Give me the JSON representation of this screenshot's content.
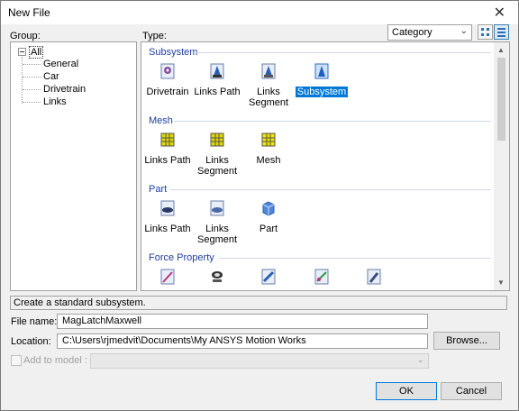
{
  "window": {
    "title": "New File",
    "close_glyph": "✕"
  },
  "group": {
    "label": "Group:",
    "root": "All",
    "children": [
      "General",
      "Car",
      "Drivetrain",
      "Links"
    ]
  },
  "type_panel": {
    "label": "Type:",
    "view_select": "Category",
    "sections": [
      {
        "title": "Subsystem",
        "items": [
          {
            "label": "Drivetrain",
            "icon": "drivetrain-icon"
          },
          {
            "label": "Links Path",
            "icon": "links-path-icon"
          },
          {
            "label": "Links Segment",
            "icon": "links-segment-icon"
          },
          {
            "label": "Subsystem",
            "icon": "subsystem-icon",
            "selected": true
          }
        ]
      },
      {
        "title": "Mesh",
        "items": [
          {
            "label": "Links Path",
            "icon": "mesh-links-path-icon"
          },
          {
            "label": "Links Segment",
            "icon": "mesh-links-segment-icon"
          },
          {
            "label": "Mesh",
            "icon": "mesh-icon"
          }
        ]
      },
      {
        "title": "Part",
        "items": [
          {
            "label": "Links Path",
            "icon": "part-links-path-icon"
          },
          {
            "label": "Links Segment",
            "icon": "part-links-segment-icon"
          },
          {
            "label": "Part",
            "icon": "part-icon"
          }
        ]
      },
      {
        "title": "Force Property",
        "items": [
          {
            "label": "",
            "icon": "force-spring-icon"
          },
          {
            "label": "",
            "icon": "force-bushing-icon"
          },
          {
            "label": "",
            "icon": "force-link-icon"
          },
          {
            "label": "",
            "icon": "force-contact-icon"
          },
          {
            "label": "",
            "icon": "force-beam-icon"
          }
        ]
      }
    ]
  },
  "description": "Create a standard subsystem.",
  "file_name": {
    "label": "File name:",
    "value": "MagLatchMaxwell"
  },
  "location": {
    "label": "Location:",
    "value": "C:\\Users\\rjmedvit\\Documents\\My ANSYS Motion Works",
    "browse": "Browse..."
  },
  "add_to_model": {
    "label": "Add to model :",
    "checked": false
  },
  "buttons": {
    "ok": "OK",
    "cancel": "Cancel"
  },
  "colors": {
    "selection": "#0078d7",
    "section_header": "#1f3f9f"
  }
}
